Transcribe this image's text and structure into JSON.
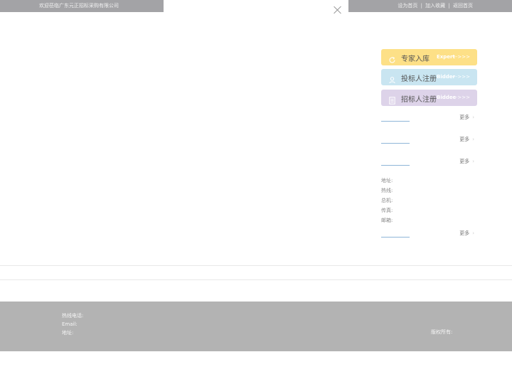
{
  "topbar": {
    "welcome": "欢迎莅临广东元正招标采购有限公司",
    "links": [
      "设为首页",
      "加入收藏",
      "返回首页"
    ],
    "separator": "|"
  },
  "modal": {
    "close_icon": "close-icon"
  },
  "side_buttons": {
    "expert": {
      "label": "专家入库",
      "en": "Expert",
      "arrow": "--->>>",
      "icon": "refresh-icon",
      "color": "#fde087"
    },
    "bidder": {
      "label": "投标人注册",
      "en": "Bidder",
      "arrow": "--->>>",
      "icon": "user-icon",
      "color": "#c9e5f1"
    },
    "biddee": {
      "label": "招标人注册",
      "en": "Biddee",
      "arrow": "--->>>",
      "icon": "document-icon",
      "color": "#ddd3e9"
    }
  },
  "sections": {
    "more_label": "更多"
  },
  "contact": {
    "address": "地址:",
    "hotline": "热线:",
    "switchboard": "总机:",
    "fax": "传真:",
    "email": "邮箱:"
  },
  "footer": {
    "hotline": "热线电话:",
    "email": "Email:",
    "address": "地址:",
    "copyright": "版权所有:"
  }
}
